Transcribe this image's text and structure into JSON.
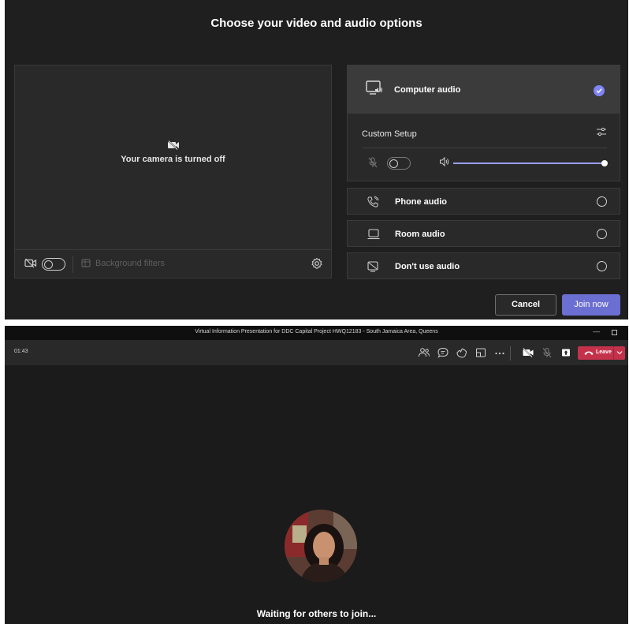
{
  "prejoin": {
    "title": "Choose your video and audio options",
    "camera_off_text": "Your camera is turned off",
    "background_filters_label": "Background filters",
    "audio_options": {
      "computer_audio": {
        "label": "Computer audio",
        "selected": true
      },
      "custom_setup_label": "Custom Setup",
      "phone_audio": {
        "label": "Phone audio",
        "selected": false
      },
      "room_audio": {
        "label": "Room audio",
        "selected": false
      },
      "no_audio": {
        "label": "Don't use audio",
        "selected": false
      }
    },
    "speaker_volume": 1.0,
    "cancel_label": "Cancel",
    "join_label": "Join now"
  },
  "meeting": {
    "window_title": "Virtual Information Presentation for DDC Capital Project HWQ12183 - South Jamaica Area, Queens",
    "elapsed_time": "01:43",
    "leave_label": "Leave",
    "waiting_text": "Waiting for others to join..."
  },
  "colors": {
    "accent": "#7f85f5",
    "join_button": "#6b6fd1",
    "leave_button": "#c4314b",
    "background_dark": "#1f1f1f"
  }
}
